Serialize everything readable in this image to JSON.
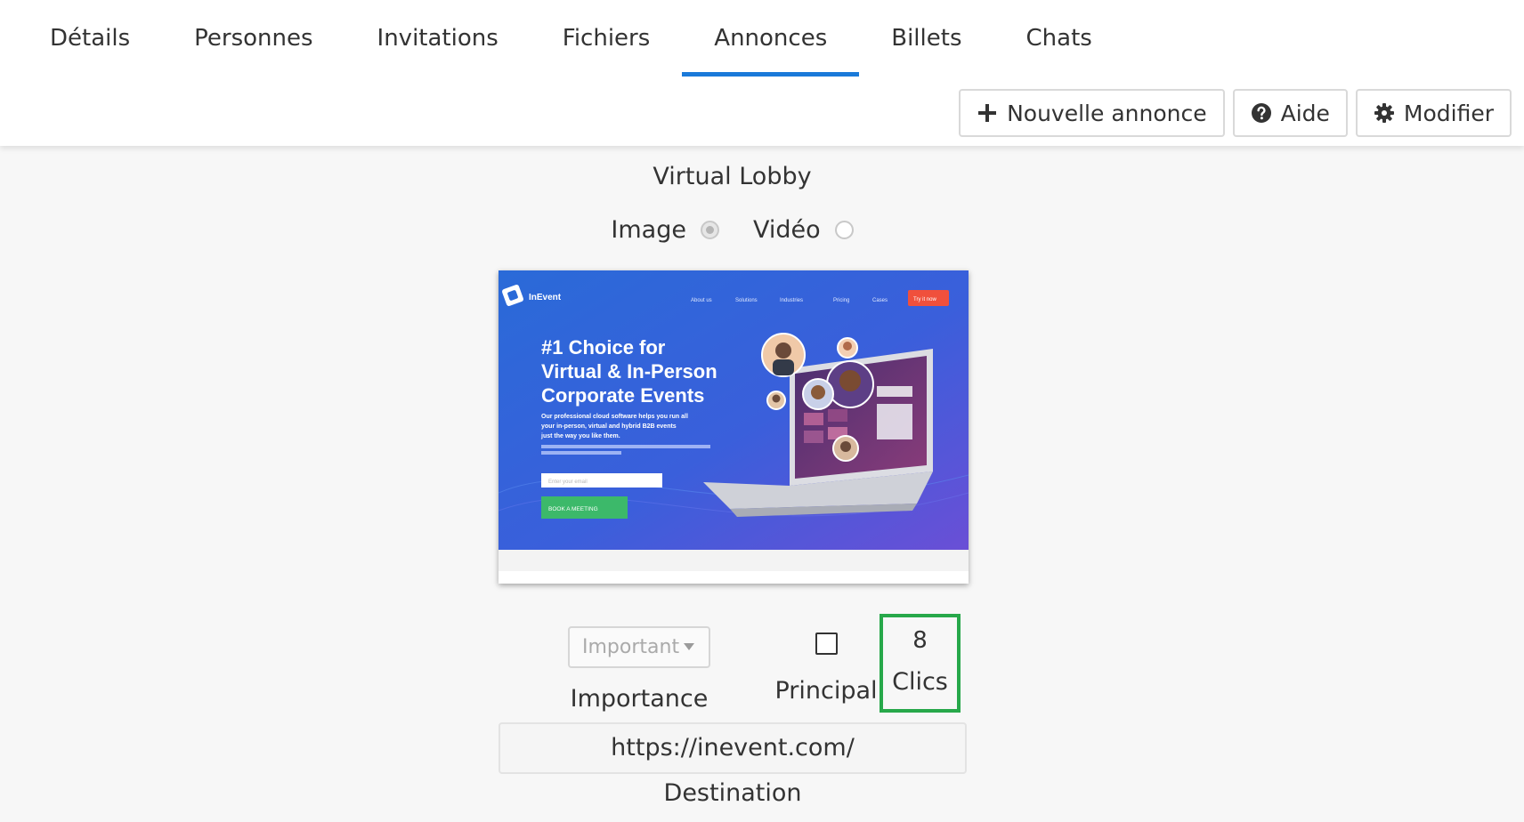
{
  "tabs": [
    {
      "label": "Détails",
      "active": false
    },
    {
      "label": "Personnes",
      "active": false
    },
    {
      "label": "Invitations",
      "active": false
    },
    {
      "label": "Fichiers",
      "active": false
    },
    {
      "label": "Annonces",
      "active": true
    },
    {
      "label": "Billets",
      "active": false
    },
    {
      "label": "Chats",
      "active": false
    }
  ],
  "toolbar": {
    "new_label": "Nouvelle annonce",
    "help_label": "Aide",
    "edit_label": "Modifier"
  },
  "ad": {
    "title": "Virtual Lobby",
    "media_image_label": "Image",
    "media_video_label": "Vidéo",
    "media_selected": "Image",
    "importance_value": "Important",
    "importance_label": "Importance",
    "principal_label": "Principal",
    "principal_checked": false,
    "clicks_count": "8",
    "clicks_label": "Clics",
    "destination_url": "https://inevent.com/",
    "destination_label": "Destination"
  },
  "preview": {
    "brand": "InEvent",
    "nav": [
      "About us",
      "Solutions",
      "Industries",
      "Pricing",
      "Cases"
    ],
    "cta": "Try it now",
    "headline_1": "#1 Choice for",
    "headline_2": "Virtual & In-Person",
    "headline_3": "Corporate Events",
    "body_1": "Our professional cloud software helps you run all",
    "body_2": "your in-person, virtual and hybrid B2B events",
    "body_3": "just the way you like them.",
    "email_placeholder": "Enter your email",
    "book_button": "BOOK A MEETING"
  },
  "colors": {
    "accent": "#1a7ad9",
    "clicks_highlight": "#27a84a",
    "preview_gradient_start": "#2a6ad8",
    "preview_gradient_end": "#6a4fd6",
    "preview_cta": "#f0503c",
    "preview_book": "#3cb96a"
  }
}
